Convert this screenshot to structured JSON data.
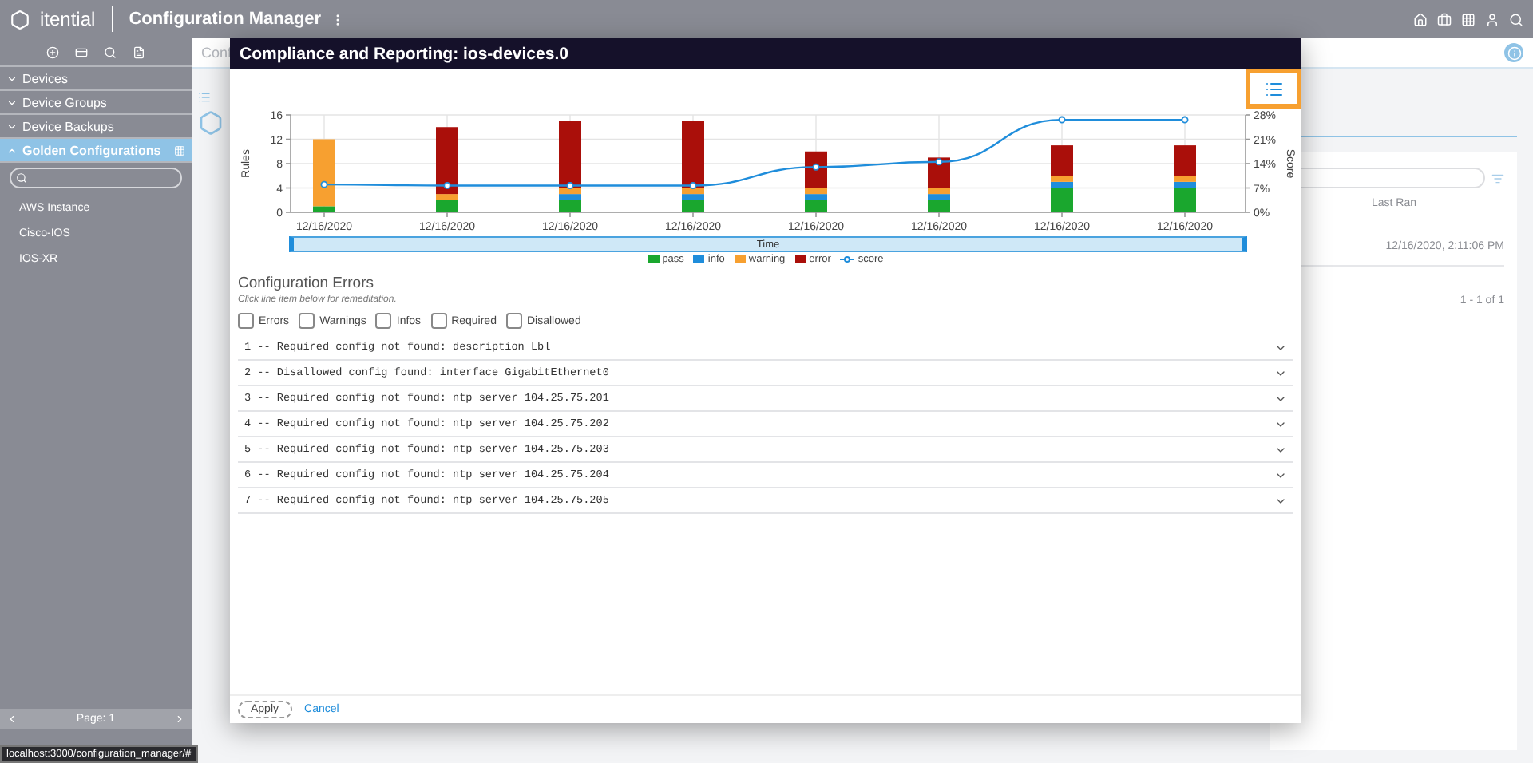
{
  "top_bar": {
    "brand": "itential",
    "app_title": "Configuration Manager"
  },
  "sidebar": {
    "sections": [
      {
        "label": "Devices",
        "expanded": false
      },
      {
        "label": "Device Groups",
        "expanded": false
      },
      {
        "label": "Device Backups",
        "expanded": false
      },
      {
        "label": "Golden Configurations",
        "expanded": true
      }
    ],
    "items": [
      "AWS Instance",
      "Cisco-IOS",
      "IOS-XR"
    ],
    "pagination": "Page: 1"
  },
  "status_url": "localhost:3000/configuration_manager/#",
  "background": {
    "breadcrumb": "Conf",
    "column_header": "Last Ran",
    "last_ran": "12/16/2020, 2:11:06 PM",
    "range": "1 - 1 of 1"
  },
  "dialog": {
    "title": "Compliance and Reporting: ios-devices.0",
    "rules_chart": {
      "chart_data": {
        "type": "bar",
        "stacked": true,
        "ylabel": "Rules",
        "xlabel": "Time",
        "grid": true,
        "legend": "bottom",
        "categories": [
          "12/16/2020",
          "12/16/2020",
          "12/16/2020",
          "12/16/2020",
          "12/16/2020",
          "12/16/2020",
          "12/16/2020",
          "12/16/2020"
        ],
        "ylim": [
          0,
          16
        ],
        "yticks": [
          0,
          4,
          8,
          12,
          16
        ],
        "series": [
          {
            "name": "pass",
            "color": "#1aa72e",
            "values": [
              1,
              2,
              2,
              2,
              2,
              2,
              4,
              4
            ]
          },
          {
            "name": "info",
            "color": "#1f8ddb",
            "values": [
              0,
              0,
              1,
              1,
              1,
              1,
              1,
              1
            ]
          },
          {
            "name": "warning",
            "color": "#f7a030",
            "values": [
              11,
              1,
              1,
              1,
              1,
              1,
              1,
              1
            ]
          },
          {
            "name": "error",
            "color": "#aa0f0a",
            "values": [
              0,
              11,
              11,
              11,
              6,
              5,
              5,
              5
            ]
          }
        ]
      }
    },
    "score_chart": {
      "chart_data": {
        "type": "line",
        "ylabel": "Score",
        "legend": "bottom",
        "ylim": [
          0,
          28
        ],
        "yticks": [
          {
            "value": 0,
            "label": "0%"
          },
          {
            "value": 7,
            "label": "7%"
          },
          {
            "value": 14,
            "label": "14%"
          },
          {
            "value": 21,
            "label": "21%"
          },
          {
            "value": 28,
            "label": "28%"
          }
        ],
        "series": [
          {
            "name": "score",
            "color": "#1f8ddb",
            "marker": "circle",
            "values": [
              8,
              7.7,
              7.7,
              7.7,
              13,
              14.5,
              26.6,
              26.6
            ]
          }
        ]
      }
    },
    "errors_title": "Configuration Errors",
    "hint": "Click line item below for remeditation.",
    "filters": [
      {
        "label": "Errors",
        "checked": false
      },
      {
        "label": "Warnings",
        "checked": false
      },
      {
        "label": "Infos",
        "checked": false
      },
      {
        "label": "Required",
        "checked": false
      },
      {
        "label": "Disallowed",
        "checked": false
      }
    ],
    "errors": [
      "1 -- Required config not found: description Lbl",
      "2 -- Disallowed config found: interface GigabitEthernet0",
      "3 -- Required config not found: ntp server 104.25.75.201",
      "4 -- Required config not found: ntp server 104.25.75.202",
      "5 -- Required config not found: ntp server 104.25.75.203",
      "6 -- Required config not found: ntp server 104.25.75.204",
      "7 -- Required config not found: ntp server 104.25.75.205"
    ],
    "buttons": [
      {
        "label": "Apply",
        "kind": "outlined"
      },
      {
        "label": "Cancel",
        "kind": "link"
      }
    ]
  }
}
